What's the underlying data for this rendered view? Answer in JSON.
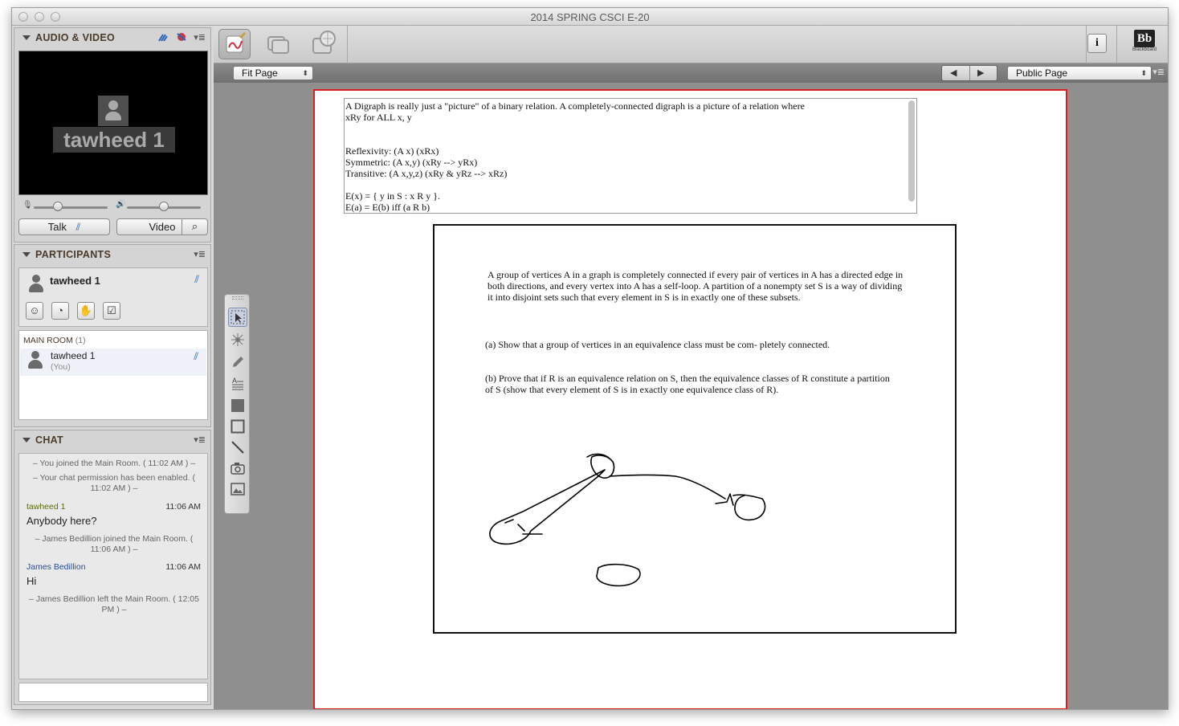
{
  "window": {
    "title": "2014 SPRING CSCI E-20"
  },
  "audio_video": {
    "title": "AUDIO & VIDEO",
    "video_name": "tawheed 1",
    "talk_label": "Talk",
    "video_label": "Video",
    "mic_level": 0.3,
    "speaker_level": 0.5
  },
  "participants": {
    "title": "PARTICIPANTS",
    "self_name": "tawheed 1",
    "room_label": "MAIN ROOM",
    "room_count": "(1)",
    "members": [
      {
        "name": "tawheed 1",
        "note": "(You)"
      }
    ]
  },
  "chat": {
    "title": "CHAT",
    "entries": [
      {
        "kind": "system",
        "text": "– You joined the Main Room. ( 11:02 AM ) –"
      },
      {
        "kind": "system",
        "text": "– Your chat permission has been enabled. ( 11:02 AM ) –"
      },
      {
        "kind": "message",
        "sender": "tawheed 1",
        "time": "11:06 AM",
        "text": "Anybody here?"
      },
      {
        "kind": "system",
        "text": "– James Bedillion joined the Main Room. ( 11:06 AM ) –"
      },
      {
        "kind": "message",
        "sender": "James Bedillion",
        "time": "11:06 AM",
        "text": "Hi"
      },
      {
        "kind": "system",
        "text": "– James Bedillion left the Main Room. ( 12:05 PM ) –"
      }
    ]
  },
  "toolbar": {
    "fit_select": "Fit Page",
    "page_select": "Public Page",
    "info_label": "i",
    "brand_logo": "Bb",
    "brand_name": "Blackboard"
  },
  "whiteboard": {
    "textbox_lines": [
      "A Digraph is really just a \"picture\" of a binary relation. A completely-connected digraph is a picture of a relation where",
      "xRy for ALL x, y",
      "",
      "",
      "Reflexivity: (A x) (xRx)",
      "Symmetric: (A x,y) (xRy --> yRx)",
      "Transitive: (A x,y,z) (xRy & yRz --> xRz)",
      "",
      "E(x) = { y in S : x R y }.",
      "E(a) = E(b) iff (a R b)"
    ],
    "problem_intro": [
      "A group of vertices A in a graph is completely connected if every pair of vertices in A has a directed edge in",
      "both directions, and every vertex into A has a self-loop. A partition of a nonempty set S is a way of dividing",
      "it into disjoint sets such that every element in S is in exactly one of these subsets."
    ],
    "part_a": "(a) Show that a group of vertices in an equivalence class must be com- pletely connected.",
    "part_b": [
      "(b) Prove that if R is an equivalence relation on S, then the equivalence classes of R constitute a partition",
      "of S (show that every element of S is in exactly one equivalence class of R)."
    ]
  },
  "colors": {
    "accent_red": "#d81e1e",
    "talk_blue": "#2a64b8",
    "sender_green": "#5a6a10",
    "sender_blue": "#2a4a9a"
  }
}
